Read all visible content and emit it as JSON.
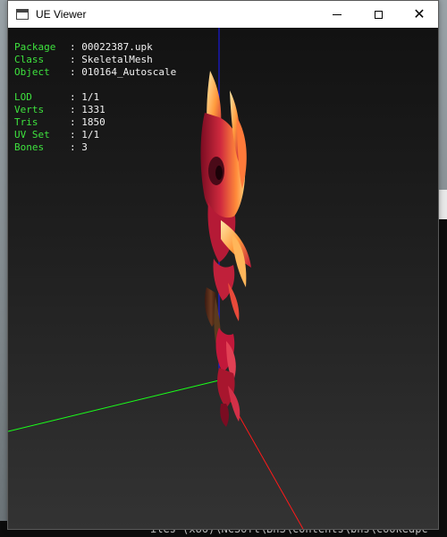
{
  "window": {
    "title": "UE Viewer",
    "controls": {
      "minimize": "minimize",
      "maximize": "maximize",
      "close": "✕"
    }
  },
  "info": {
    "package_label": "Package",
    "package_value": "00022387.upk",
    "class_label": "Class",
    "class_value": "SkeletalMesh",
    "object_label": "Object",
    "object_value": "010164_Autoscale",
    "lod_label": "LOD",
    "lod_value": "1/1",
    "verts_label": "Verts",
    "verts_value": "1331",
    "tris_label": "Tris",
    "tris_value": "1850",
    "uvset_label": "UV Set",
    "uvset_value": "1/1",
    "bones_label": "Bones",
    "bones_value": "3",
    "separator": ": "
  },
  "background_terminal": {
    "bottom_text": "iles (x86)\\NCSoft\\BnS\\contents\\bns\\cookedpc"
  },
  "colors": {
    "label_green": "#3ee23e",
    "axis_x": "#ff1a1a",
    "axis_y": "#1aff1a",
    "axis_z": "#1a1aff",
    "mesh_red": "#c2183a",
    "mesh_glow": "#ffd27a"
  },
  "icons": {
    "app": "window-icon",
    "minimize": "minimize-icon",
    "maximize": "maximize-icon",
    "close": "close-icon"
  }
}
